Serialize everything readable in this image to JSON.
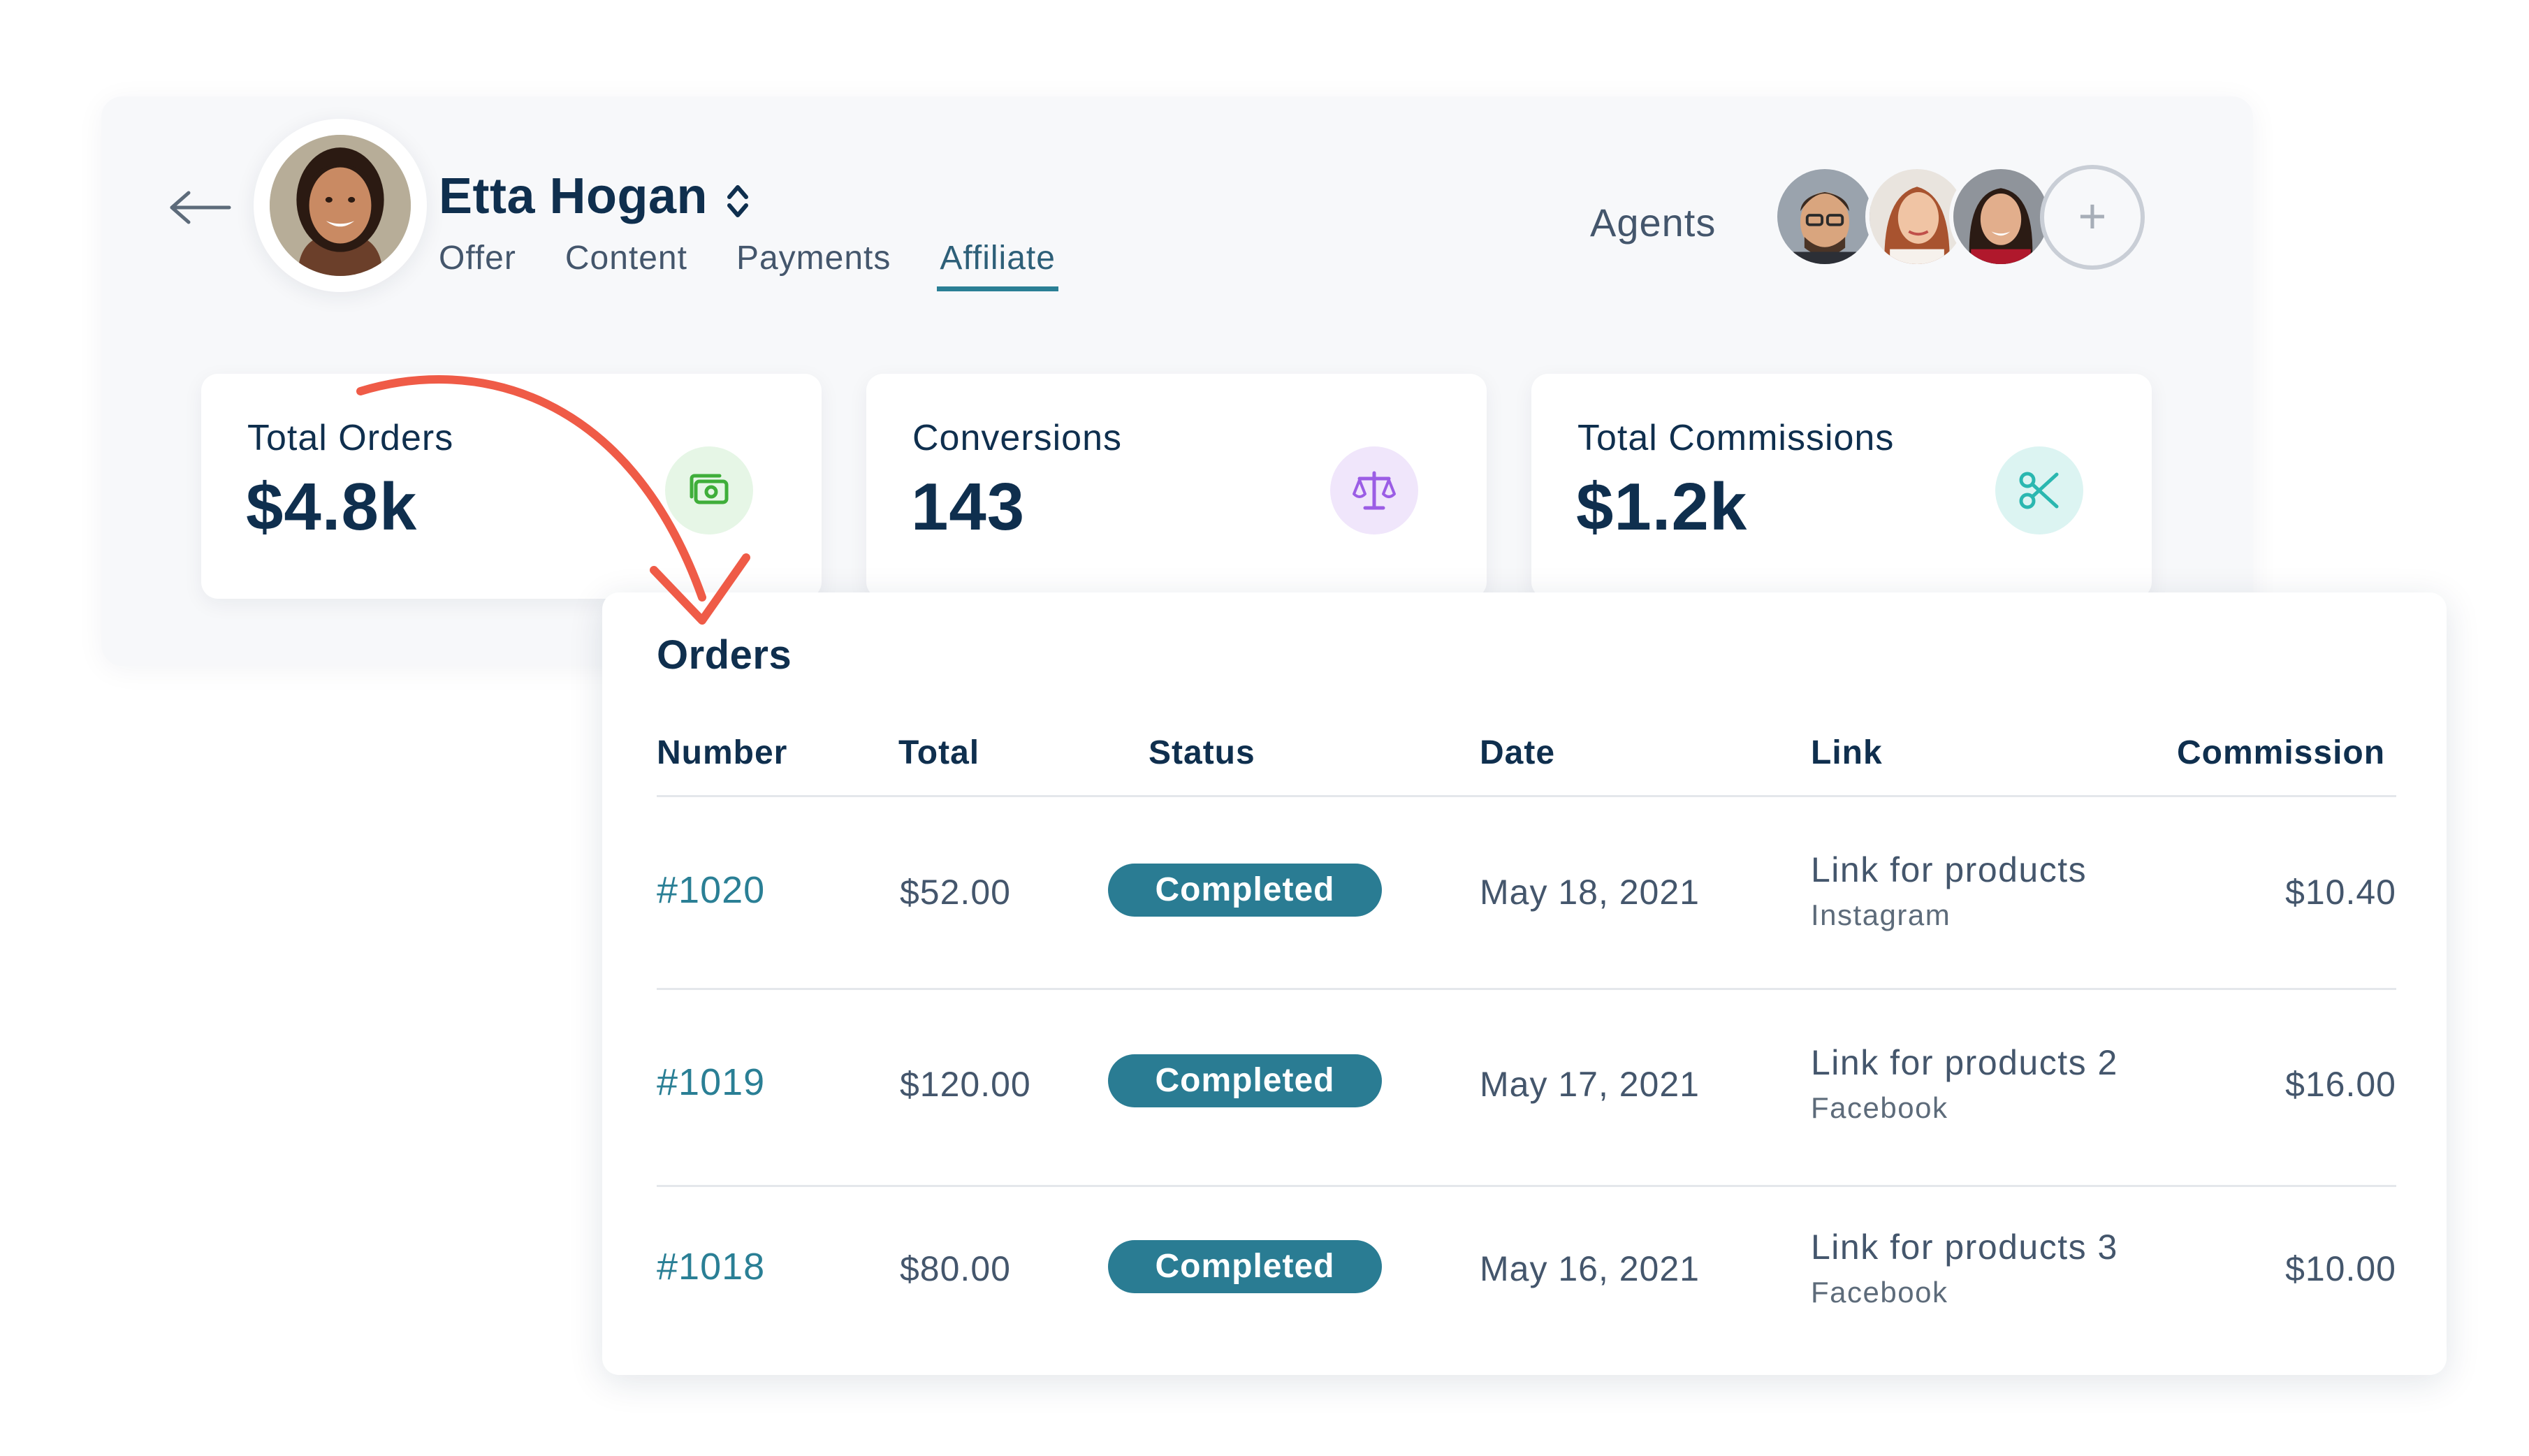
{
  "profile": {
    "name": "Etta Hogan",
    "tabs": [
      {
        "label": "Offer",
        "active": false
      },
      {
        "label": "Content",
        "active": false
      },
      {
        "label": "Payments",
        "active": false
      },
      {
        "label": "Affiliate",
        "active": true
      }
    ]
  },
  "agents": {
    "label": "Agents",
    "add_label": "+"
  },
  "stats": [
    {
      "label": "Total Orders",
      "value": "$4.8k",
      "icon": "cash-icon",
      "color": "#3fae3a"
    },
    {
      "label": "Conversions",
      "value": "143",
      "icon": "scale-icon",
      "color": "#9b5de5"
    },
    {
      "label": "Total Commissions",
      "value": "$1.2k",
      "icon": "scissors-icon",
      "color": "#2ab7b0"
    }
  ],
  "orders": {
    "title": "Orders",
    "columns": [
      "Number",
      "Total",
      "Status",
      "Date",
      "Link",
      "Commission"
    ],
    "rows": [
      {
        "number": "#1020",
        "total": "$52.00",
        "status": "Completed",
        "date": "May 18, 2021",
        "link": "Link for products",
        "source": "Instagram",
        "commission": "$10.40"
      },
      {
        "number": "#1019",
        "total": "$120.00",
        "status": "Completed",
        "date": "May 17, 2021",
        "link": "Link for products 2",
        "source": "Facebook",
        "commission": "$16.00"
      },
      {
        "number": "#1018",
        "total": "$80.00",
        "status": "Completed",
        "date": "May 16, 2021",
        "link": "Link for products 3",
        "source": "Facebook",
        "commission": "$10.00"
      }
    ]
  },
  "colors": {
    "accent": "#2a7f95",
    "badge": "#2a7c93",
    "text_dark": "#0f2f4e",
    "text_muted": "#44566c",
    "annotation": "#ef5b47"
  }
}
